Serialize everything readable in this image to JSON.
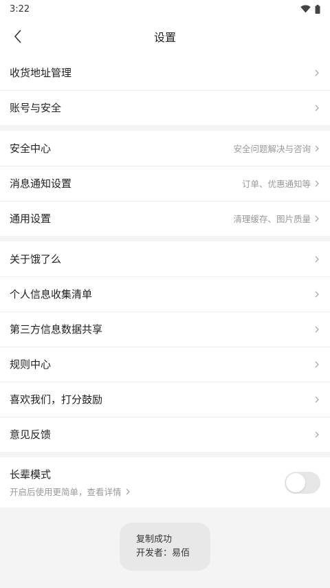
{
  "status_bar": {
    "time": "3:22"
  },
  "header": {
    "title": "设置"
  },
  "group1": [
    {
      "label": "收货地址管理",
      "hint": ""
    },
    {
      "label": "账号与安全",
      "hint": ""
    }
  ],
  "group2": [
    {
      "label": "安全中心",
      "hint": "安全问题解决与咨询"
    },
    {
      "label": "消息通知设置",
      "hint": "订单、优惠通知等"
    },
    {
      "label": "通用设置",
      "hint": "清理缓存、图片质量"
    }
  ],
  "group3": [
    {
      "label": "关于饿了么",
      "hint": ""
    },
    {
      "label": "个人信息收集清单",
      "hint": ""
    },
    {
      "label": "第三方信息数据共享",
      "hint": ""
    },
    {
      "label": "规则中心",
      "hint": ""
    },
    {
      "label": "喜欢我们，打分鼓励",
      "hint": ""
    },
    {
      "label": "意见反馈",
      "hint": ""
    }
  ],
  "elder_mode": {
    "title": "长辈模式",
    "subtitle": "开启后使用更简单，查看详情",
    "enabled": false
  },
  "toast": {
    "line1": "复制成功",
    "line2": "开发者：易佰"
  }
}
